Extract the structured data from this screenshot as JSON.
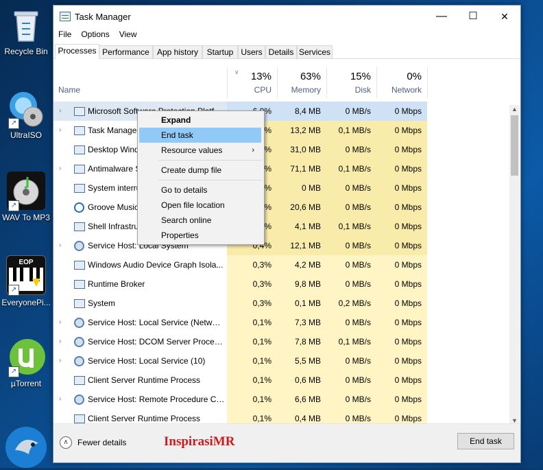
{
  "desktop": {
    "icons": [
      {
        "label": "Recycle Bin",
        "icon": "recycle-bin-icon"
      },
      {
        "label": "UltraISO",
        "icon": "ultraiso-icon"
      },
      {
        "label": "WAV To MP3",
        "icon": "wav-to-mp3-icon"
      },
      {
        "label": "EveryonePi...",
        "icon": "everyonepiano-icon",
        "badge": "EOP"
      },
      {
        "label": "µTorrent",
        "icon": "utorrent-icon"
      }
    ]
  },
  "window": {
    "title": "Task Manager",
    "controls": {
      "minimize": "—",
      "maximize": "☐",
      "close": "✕"
    },
    "menu": [
      "File",
      "Options",
      "View"
    ],
    "tabs": [
      "Processes",
      "Performance",
      "App history",
      "Startup",
      "Users",
      "Details",
      "Services"
    ],
    "active_tab": "Processes"
  },
  "table": {
    "name_header": "Name",
    "columns": [
      {
        "percent": "13%",
        "label": "CPU"
      },
      {
        "percent": "63%",
        "label": "Memory"
      },
      {
        "percent": "15%",
        "label": "Disk"
      },
      {
        "percent": "0%",
        "label": "Network"
      }
    ],
    "rows": [
      {
        "name": "Microsoft Software Protection Platf...",
        "cpu": "6,0%",
        "mem": "8,4 MB",
        "disk": "0 MB/s",
        "net": "0 Mbps",
        "expand": true,
        "icon": "sys"
      },
      {
        "name": "Task Manager",
        "cpu": "1,3%",
        "mem": "13,2 MB",
        "disk": "0,1 MB/s",
        "net": "0 Mbps",
        "expand": true,
        "icon": "sys"
      },
      {
        "name": "Desktop Window Manager",
        "cpu": "0,8%",
        "mem": "31,0 MB",
        "disk": "0 MB/s",
        "net": "0 Mbps",
        "expand": false,
        "icon": "sys"
      },
      {
        "name": "Antimalware Service Executable",
        "cpu": "0,8%",
        "mem": "71,1 MB",
        "disk": "0,1 MB/s",
        "net": "0 Mbps",
        "expand": true,
        "icon": "sys"
      },
      {
        "name": "System interrupts",
        "cpu": "0,6%",
        "mem": "0 MB",
        "disk": "0 MB/s",
        "net": "0 Mbps",
        "expand": false,
        "icon": "sys"
      },
      {
        "name": "Groove Music",
        "cpu": "0,6%",
        "mem": "20,6 MB",
        "disk": "0 MB/s",
        "net": "0 Mbps",
        "expand": false,
        "icon": "groove"
      },
      {
        "name": "Shell Infrastructure Host",
        "cpu": "0,4%",
        "mem": "4,1 MB",
        "disk": "0,1 MB/s",
        "net": "0 Mbps",
        "expand": false,
        "icon": "sys"
      },
      {
        "name": "Service Host: Local System",
        "cpu": "0,4%",
        "mem": "12,1 MB",
        "disk": "0 MB/s",
        "net": "0 Mbps",
        "expand": true,
        "icon": "gear"
      },
      {
        "name": "Windows Audio Device Graph Isola...",
        "cpu": "0,3%",
        "mem": "4,2 MB",
        "disk": "0 MB/s",
        "net": "0 Mbps",
        "expand": false,
        "icon": "sys"
      },
      {
        "name": "Runtime Broker",
        "cpu": "0,3%",
        "mem": "9,8 MB",
        "disk": "0 MB/s",
        "net": "0 Mbps",
        "expand": false,
        "icon": "sys"
      },
      {
        "name": "System",
        "cpu": "0,3%",
        "mem": "0,1 MB",
        "disk": "0,2 MB/s",
        "net": "0 Mbps",
        "expand": false,
        "icon": "sys"
      },
      {
        "name": "Service Host: Local Service (Networ...",
        "cpu": "0,1%",
        "mem": "7,3 MB",
        "disk": "0 MB/s",
        "net": "0 Mbps",
        "expand": true,
        "icon": "gear"
      },
      {
        "name": "Service Host: DCOM Server Process...",
        "cpu": "0,1%",
        "mem": "7,8 MB",
        "disk": "0,1 MB/s",
        "net": "0 Mbps",
        "expand": true,
        "icon": "gear"
      },
      {
        "name": "Service Host: Local Service (10)",
        "cpu": "0,1%",
        "mem": "5,5 MB",
        "disk": "0 MB/s",
        "net": "0 Mbps",
        "expand": true,
        "icon": "gear"
      },
      {
        "name": "Client Server Runtime Process",
        "cpu": "0,1%",
        "mem": "0,6 MB",
        "disk": "0 MB/s",
        "net": "0 Mbps",
        "expand": false,
        "icon": "sys"
      },
      {
        "name": "Service Host: Remote Procedure Ca...",
        "cpu": "0,1%",
        "mem": "6,6 MB",
        "disk": "0 MB/s",
        "net": "0 Mbps",
        "expand": true,
        "icon": "gear"
      },
      {
        "name": "Client Server Runtime Process",
        "cpu": "0,1%",
        "mem": "0,4 MB",
        "disk": "0 MB/s",
        "net": "0 Mbps",
        "expand": false,
        "icon": "sys"
      }
    ],
    "selected_index": 0
  },
  "context_menu": {
    "items": [
      {
        "label": "Expand",
        "bold": true
      },
      {
        "label": "End task",
        "highlighted": true
      },
      {
        "label": "Resource values",
        "submenu": true
      },
      {
        "separator": true
      },
      {
        "label": "Create dump file"
      },
      {
        "separator": true
      },
      {
        "label": "Go to details"
      },
      {
        "label": "Open file location"
      },
      {
        "label": "Search online"
      },
      {
        "label": "Properties"
      }
    ]
  },
  "footer": {
    "fewer_details": "Fewer details",
    "end_task": "End task",
    "watermark": "InspirasiMR"
  },
  "colors": {
    "cpu_heat": "#fff4c4",
    "highlight": "#91c9f7",
    "selected_row": "#cfe2f5",
    "watermark": "#d01a1a"
  }
}
